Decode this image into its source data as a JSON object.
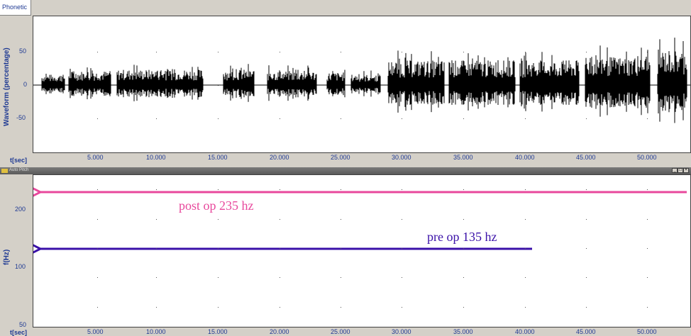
{
  "top_panel": {
    "tab_label": "Phonetic",
    "y_axis_label": "Waveform (percentage)",
    "t_label": "t[sec]",
    "y_ticks": [
      "50",
      "0",
      "-50"
    ],
    "x_ticks": [
      "5.000",
      "10.000",
      "15.000",
      "20.000",
      "25.000",
      "30.000",
      "35.000",
      "40.000",
      "45.000",
      "50.000"
    ]
  },
  "bottom_panel": {
    "window_title": "Auto Pitch",
    "window_buttons": [
      "_",
      "□",
      "×"
    ],
    "y_axis_label": "f(Hz)",
    "t_label": "t[sec]",
    "y_ticks": [
      "200",
      "100",
      "50"
    ],
    "x_ticks": [
      "5.000",
      "10.000",
      "15.000",
      "20.000",
      "25.000",
      "30.000",
      "35.000",
      "40.000",
      "45.000",
      "50.000"
    ],
    "annotations": {
      "post": {
        "text": "post op 235 hz",
        "color": "#e8489c"
      },
      "pre": {
        "text": "pre op 135 hz",
        "color": "#3a10a8"
      }
    }
  },
  "colors": {
    "axis": "#1f3a93",
    "waveform": "#000000",
    "pink": "#e8489c",
    "blue": "#3a10a8"
  }
}
